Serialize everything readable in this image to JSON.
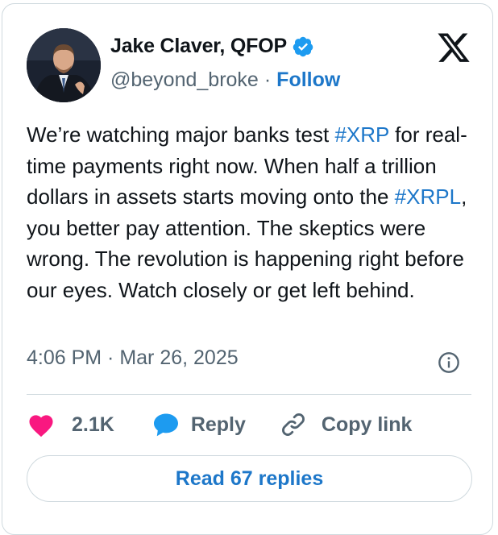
{
  "author": {
    "name": "Jake Claver, QFOP",
    "handle": "@beyond_broke",
    "separator": "·",
    "follow_label": "Follow",
    "verified_icon": "verified-badge-icon",
    "avatar_icon": "profile-photo"
  },
  "brand": {
    "logo_icon": "x-logo-icon"
  },
  "tweet": {
    "segments": [
      {
        "type": "text",
        "text": "We’re watching major banks test "
      },
      {
        "type": "hashtag",
        "text": "#XRP"
      },
      {
        "type": "text",
        "text": " for real-time payments right now. When half a trillion dollars in assets starts moving onto the "
      },
      {
        "type": "hashtag",
        "text": "#XRPL"
      },
      {
        "type": "text",
        "text": ", you better pay attention. The skeptics were wrong. The revolution is happening right before our eyes. Watch closely or get left behind."
      }
    ],
    "timestamp": "4:06 PM · Mar 26, 2025"
  },
  "actions": {
    "like_count": "2.1K",
    "reply_label": "Reply",
    "copy_link_label": "Copy link",
    "read_replies_label": "Read 67 replies"
  },
  "colors": {
    "link_blue": "#1d77c9",
    "like_pink": "#f91880",
    "reply_blue": "#1d9bf0",
    "verified_blue": "#1d9bf0",
    "text_primary": "#0f1419",
    "text_secondary": "#536471",
    "border": "#cfd9de"
  }
}
